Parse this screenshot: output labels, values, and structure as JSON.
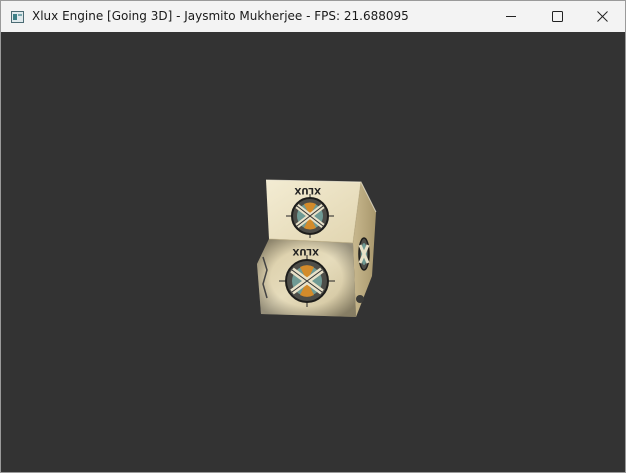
{
  "window": {
    "title": "Xlux Engine [Going 3D] - Jaysmito Mukherjee - FPS: 21.688095",
    "minimize_icon": "minimize-icon",
    "maximize_icon": "maximize-icon",
    "close_icon": "close-icon"
  },
  "scene": {
    "object": "textured-cube",
    "texture_text": "XLUX",
    "background_color": "#333333",
    "cube_face_color": "#e9dfbd"
  }
}
